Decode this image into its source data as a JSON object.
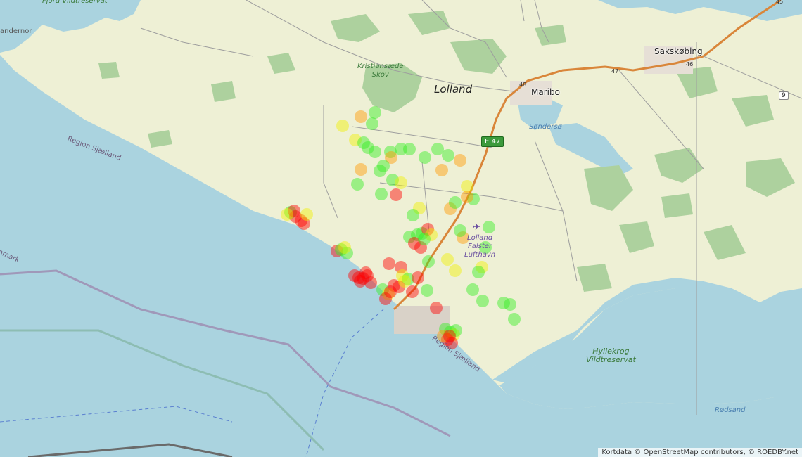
{
  "map": {
    "labels": {
      "island": "Lolland",
      "maribo": "Maribo",
      "sakskobing": "Sakskøbing",
      "sondersø": "Søndersø",
      "kristiansaede": "Kristiansæde\nSkov",
      "region1": "Region Sjælland",
      "region2": "Region Sjælland",
      "region_partial": "Sjælland",
      "denmark": "nmark",
      "fjord": "Fjord Vildtreservat",
      "sandernor": "andernor",
      "airport": "Lolland\nFalster\nLufthavn",
      "hyllekrog": "Hyllekrog\nVildtreservat",
      "rodsand": "Rødsand"
    },
    "roads": {
      "e47": "E 47",
      "r9": "9",
      "r46": "46",
      "r47": "47",
      "r48": "48",
      "r45": "45"
    },
    "attribution": "Kortdata © OpenStreetMap contributors, © ROEDBY.net",
    "colors": {
      "sea": "#aad3df",
      "land": "#f2efe9",
      "field": "#eef0d5",
      "forest": "#add19e",
      "motorway": "#e892a2",
      "trunk": "#d9863a",
      "red": "#ff0000",
      "green": "#33ee22",
      "yellow": "#f0f000",
      "orange": "#ff9900"
    },
    "marker_legend": [
      "red",
      "orange",
      "yellow",
      "green"
    ]
  }
}
